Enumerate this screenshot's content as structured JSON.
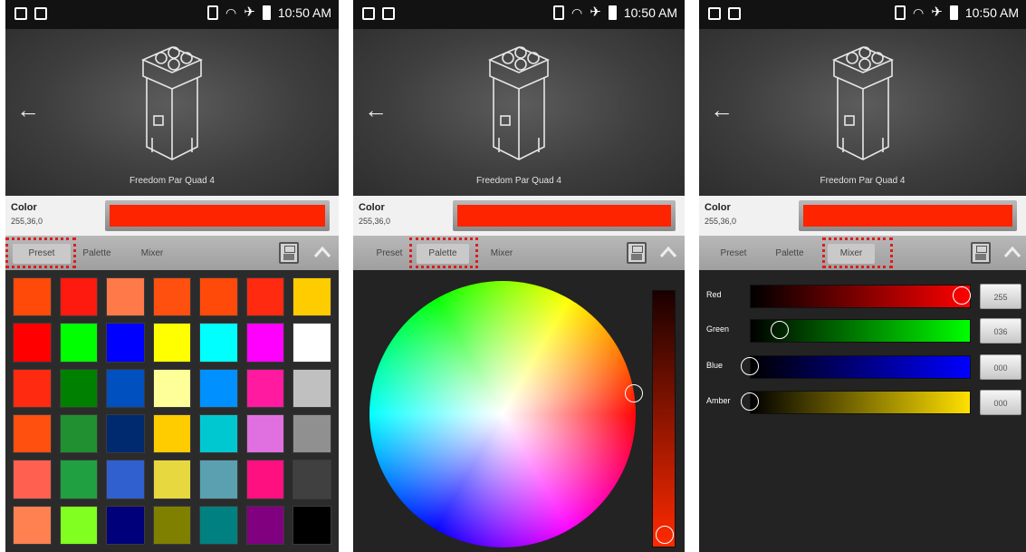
{
  "status_bar": {
    "time": "10:50 AM"
  },
  "device": {
    "name": "Freedom Par Quad 4"
  },
  "color": {
    "label": "Color",
    "value": "255,36,0",
    "swatch": "#ff2400"
  },
  "tabs": {
    "preset": "Preset",
    "palette": "Palette",
    "mixer": "Mixer"
  },
  "preset_colors": [
    "#ff4a0a",
    "#ff1a10",
    "#ff7a48",
    "#ff5010",
    "#ff4a0a",
    "#ff2a10",
    "#ffcc00",
    "#ff0000",
    "#00ff00",
    "#0000ff",
    "#ffff00",
    "#00ffff",
    "#ff00ff",
    "#ffffff",
    "#ff2a10",
    "#008000",
    "#0050c0",
    "#ffff99",
    "#0090ff",
    "#ff1aa0",
    "#c0c0c0",
    "#ff5010",
    "#209030",
    "#002a70",
    "#ffcc00",
    "#00c8d0",
    "#e070e0",
    "#909090",
    "#ff6050",
    "#20a040",
    "#3060d0",
    "#e8d840",
    "#5aa0b0",
    "#ff1080",
    "#404040",
    "#ff8050",
    "#80ff20",
    "#00007a",
    "#808000",
    "#008080",
    "#800080",
    "#000000"
  ],
  "mixer": {
    "channels": [
      {
        "name": "Red",
        "value": "255",
        "level": 1.0,
        "color": "#ff0000"
      },
      {
        "name": "Green",
        "value": "036",
        "level": 0.141,
        "color": "#00ff00"
      },
      {
        "name": "Blue",
        "value": "000",
        "level": 0.0,
        "color": "#0000ff"
      },
      {
        "name": "Amber",
        "value": "000",
        "level": 0.0,
        "color": "#ffe000"
      }
    ]
  }
}
